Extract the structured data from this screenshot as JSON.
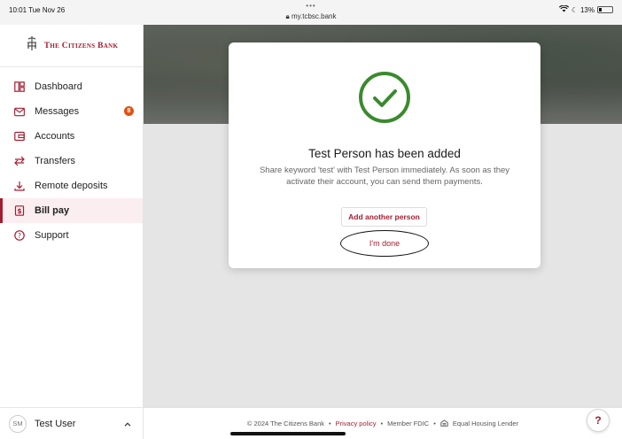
{
  "status_bar": {
    "time": "10:01",
    "date": "Tue Nov 26",
    "dots": "•••",
    "url": "my.tcbsc.bank",
    "battery": "13%"
  },
  "sidebar": {
    "logo_text": "The Citizens Bank",
    "items": [
      {
        "label": "Dashboard",
        "icon": "dashboard-icon"
      },
      {
        "label": "Messages",
        "icon": "mail-icon",
        "badge": "8"
      },
      {
        "label": "Accounts",
        "icon": "wallet-icon"
      },
      {
        "label": "Transfers",
        "icon": "transfer-arrows-icon"
      },
      {
        "label": "Remote deposits",
        "icon": "deposit-download-icon"
      },
      {
        "label": "Bill pay",
        "icon": "bill-icon",
        "active": true
      },
      {
        "label": "Support",
        "icon": "help-circle-icon"
      }
    ],
    "user": {
      "initials": "SM",
      "name": "Test User"
    }
  },
  "modal": {
    "title": "Test Person has been added",
    "body": "Share keyword 'test' with Test Person immediately. As soon as they activate their account, you can send them payments.",
    "add_button": "Add another person",
    "done_button": "I'm done"
  },
  "footer": {
    "copyright": "© 2024 The Citizens Bank",
    "sep": "•",
    "privacy": "Privacy policy",
    "fdic": "Member FDIC",
    "equal_housing": "Equal Housing Lender"
  },
  "help_button": "?",
  "colors": {
    "brand": "#a51c30",
    "success": "#3a8a2e",
    "badge": "#e0520f"
  }
}
